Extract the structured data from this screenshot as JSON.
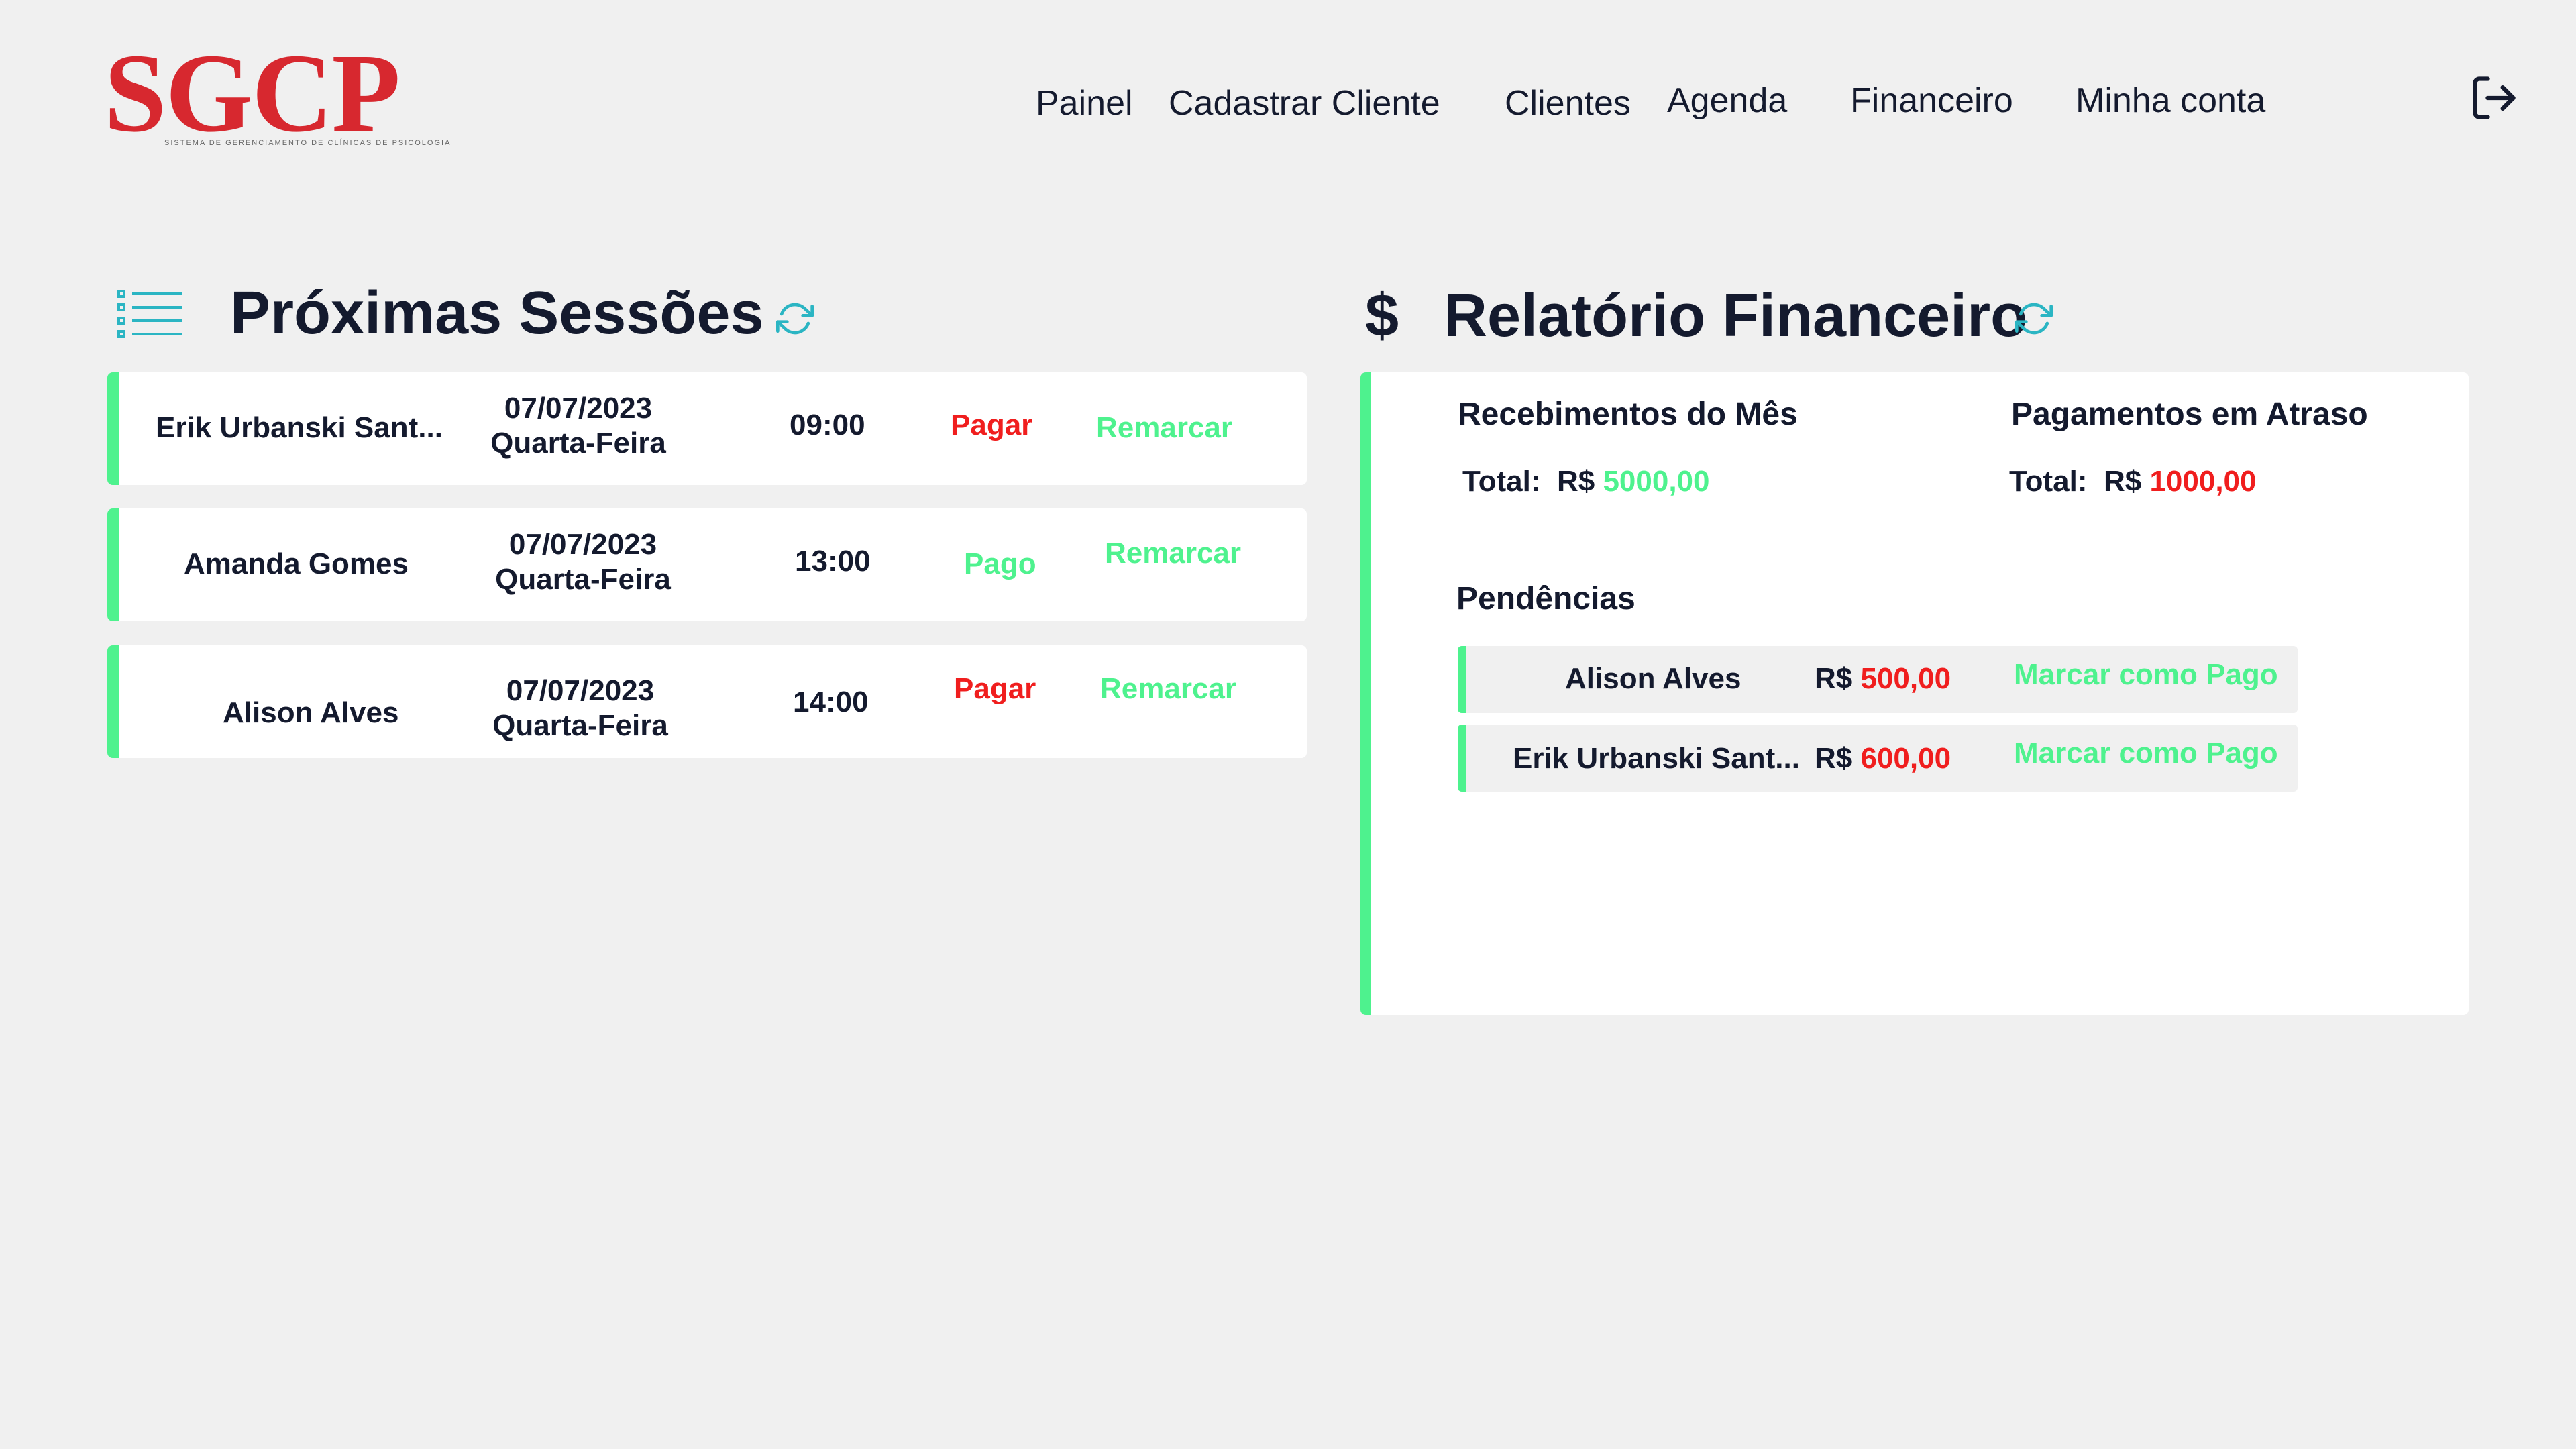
{
  "brand": {
    "logo_text": "SGCP",
    "logo_subtitle": "SISTEMA DE GERENCIAMENTO DE CLÍNICAS DE PSICOLOGIA"
  },
  "nav": {
    "painel": "Painel",
    "cadastrar_cliente": "Cadastrar Cliente",
    "clientes": "Clientes",
    "agenda": "Agenda",
    "financeiro": "Financeiro",
    "minha_conta": "Minha conta"
  },
  "icons": {
    "logout": "logout-icon",
    "list": "list-icon",
    "refresh": "refresh-icon",
    "dollar": "$"
  },
  "colors": {
    "accent_green": "#4ef28e",
    "alert_red": "#f01e1e",
    "brand_red": "#d7282f",
    "text_dark": "#141a2e",
    "icon_teal": "#2bb5c3"
  },
  "sessions": {
    "title": "Próximas Sessões",
    "items": [
      {
        "client": "Erik Urbanski Sant...",
        "date": "07/07/2023",
        "weekday": "Quarta-Feira",
        "time": "09:00",
        "status": "Pagar",
        "action": "Remarcar"
      },
      {
        "client": "Amanda Gomes",
        "date": "07/07/2023",
        "weekday": "Quarta-Feira",
        "time": "13:00",
        "status": "Pago",
        "action": "Remarcar"
      },
      {
        "client": "Alison Alves",
        "date": "07/07/2023",
        "weekday": "Quarta-Feira",
        "time": "14:00",
        "status": "Pagar",
        "action": "Remarcar"
      }
    ]
  },
  "finance": {
    "title": "Relatório Financeiro",
    "receipts": {
      "heading": "Recebimentos do Mês",
      "total_label": "Total:",
      "currency": "R$",
      "value": "5000,00"
    },
    "overdue": {
      "heading": "Pagamentos em Atraso",
      "total_label": "Total:",
      "currency": "R$",
      "value": "1000,00"
    },
    "pending": {
      "heading": "Pendências",
      "items": [
        {
          "client": "Alison Alves",
          "currency": "R$",
          "value": "500,00",
          "action": "Marcar como Pago"
        },
        {
          "client": "Erik Urbanski Sant...",
          "currency": "R$",
          "value": "600,00",
          "action": "Marcar como Pago"
        }
      ]
    }
  }
}
